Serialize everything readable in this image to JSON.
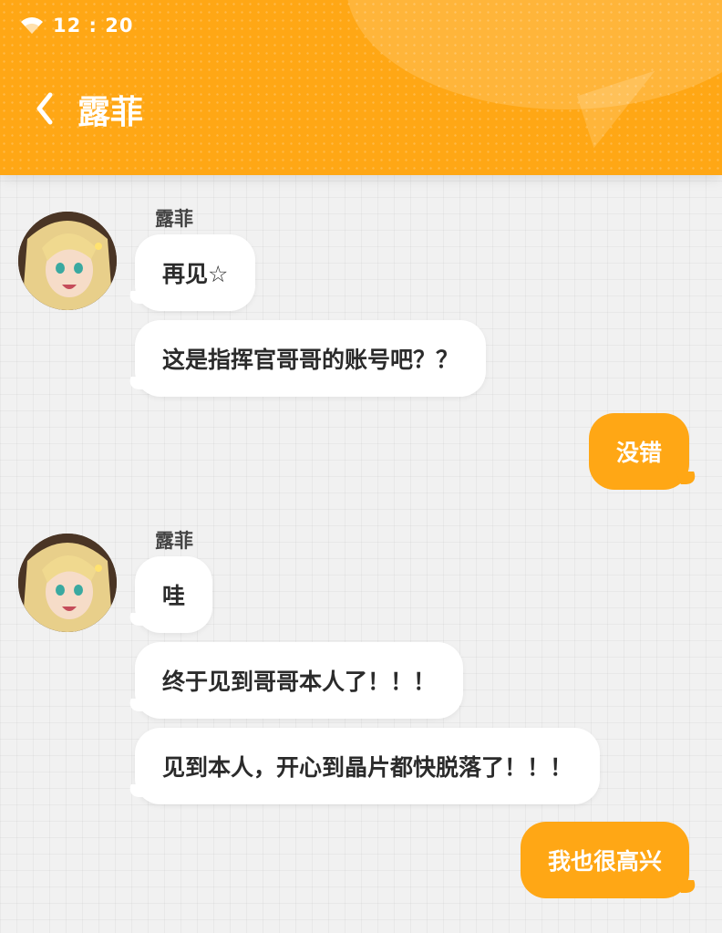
{
  "status_bar": {
    "time": "12 : 20",
    "wifi_icon": "wifi-icon"
  },
  "header": {
    "title": "露菲",
    "back_icon": "chevron-left-icon"
  },
  "colors": {
    "accent": "#ffa715",
    "background": "#f1f1f1",
    "bubble_left": "#ffffff"
  },
  "messages": [
    {
      "side": "left",
      "sender": "露菲",
      "text": "再见☆"
    },
    {
      "side": "left",
      "text": "这是指挥官哥哥的账号吧？？"
    },
    {
      "side": "right",
      "text": "没错"
    },
    {
      "side": "left",
      "sender": "露菲",
      "text": "哇"
    },
    {
      "side": "left",
      "text": "终于见到哥哥本人了！！！"
    },
    {
      "side": "left",
      "text": "见到本人，开心到晶片都快脱落了！！！"
    },
    {
      "side": "right",
      "text": "我也很高兴"
    }
  ]
}
